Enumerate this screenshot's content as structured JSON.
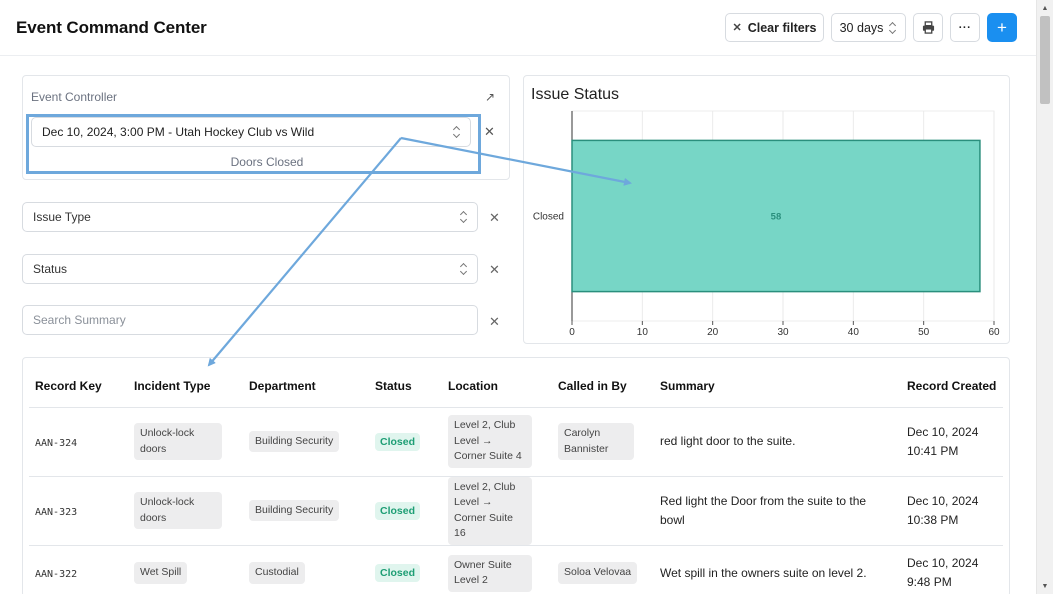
{
  "header": {
    "title": "Event Command Center",
    "clear_filters_label": "Clear filters",
    "range_label": "30 days",
    "add_label": "+"
  },
  "controller": {
    "label": "Event Controller",
    "selected_event": "Dec 10, 2024, 3:00 PM - Utah Hockey Club vs Wild",
    "door_status": "Doors Closed"
  },
  "filters": {
    "issue_type_value": "Issue Type",
    "status_value": "Status",
    "search_placeholder": "Search Summary"
  },
  "chart_data": {
    "type": "bar",
    "title": "Issue Status",
    "orientation": "horizontal",
    "categories": [
      "Closed"
    ],
    "values": [
      58
    ],
    "xlim": [
      0,
      60
    ],
    "xticks": [
      0,
      10,
      20,
      30,
      40,
      50,
      60
    ],
    "grid": true,
    "color": "#77d6c6",
    "edge_color": "#2a8f7d",
    "label_color": "#2a8f7d"
  },
  "table": {
    "columns": [
      "Record Key",
      "Incident Type",
      "Department",
      "Status",
      "Location",
      "Called in By",
      "Summary",
      "Record Created"
    ],
    "rows": [
      {
        "key": "AAN-324",
        "incident_type": "Unlock-lock doors",
        "department": "Building Security",
        "status": "Closed",
        "location": "Level 2, Club Level → Corner Suite 4",
        "called_in_by": "Carolyn Bannister",
        "summary": "red light door to the suite.",
        "created_date": "Dec 10, 2024",
        "created_time": "10:41 PM"
      },
      {
        "key": "AAN-323",
        "incident_type": "Unlock-lock doors",
        "department": "Building Security",
        "status": "Closed",
        "location": "Level 2, Club Level → Corner Suite 16",
        "called_in_by": "",
        "summary": "Red light the Door from the suite to the bowl",
        "created_date": "Dec 10, 2024",
        "created_time": "10:38 PM"
      },
      {
        "key": "AAN-322",
        "incident_type": "Wet Spill",
        "department": "Custodial",
        "status": "Closed",
        "location": "Owner Suite Level 2",
        "called_in_by": "Soloa Velovaa",
        "summary": "Wet spill in the owners suite on level 2.",
        "created_date": "Dec 10, 2024",
        "created_time": "9:48 PM"
      }
    ]
  },
  "colors": {
    "primary": "#1a8ff0",
    "annotation": "#6ea8dc",
    "status_closed_bg": "#e0f5ee",
    "status_closed_text": "#1d9e74"
  }
}
